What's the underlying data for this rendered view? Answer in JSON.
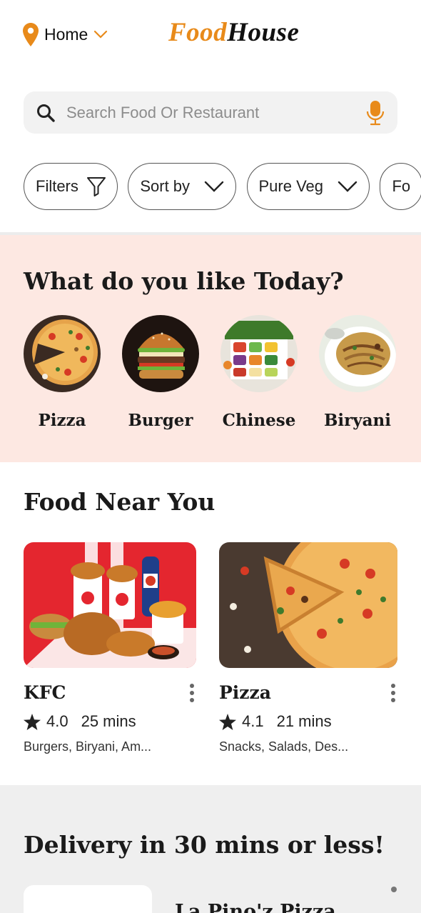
{
  "header": {
    "location_label": "Home",
    "logo_part1": "Food",
    "logo_part2": "House"
  },
  "search": {
    "placeholder": "Search Food Or Restaurant"
  },
  "chips": [
    {
      "label": "Filters",
      "icon": "filter-icon"
    },
    {
      "label": "Sort by",
      "icon": "chevron-down-icon"
    },
    {
      "label": "Pure Veg",
      "icon": "chevron-down-icon"
    },
    {
      "label": "Fo",
      "icon": ""
    }
  ],
  "categories": {
    "title": "What do you like Today?",
    "items": [
      {
        "label": "Pizza"
      },
      {
        "label": "Burger"
      },
      {
        "label": "Chinese"
      },
      {
        "label": "Biryani"
      }
    ]
  },
  "near": {
    "title": "Food Near You",
    "cards": [
      {
        "name": "KFC",
        "rating": "4.0",
        "time": "25 mins",
        "tags": "Burgers, Biryani, Am..."
      },
      {
        "name": "Pizza",
        "rating": "4.1",
        "time": "21 mins",
        "tags": "Snacks, Salads, Des..."
      }
    ]
  },
  "delivery": {
    "title": "Delivery in 30 mins or less!",
    "first_name": "La Pino'z Pizza"
  },
  "colors": {
    "accent": "#e88a1a",
    "category_bg": "#fde8e2",
    "kfc_red": "#e4262f"
  }
}
